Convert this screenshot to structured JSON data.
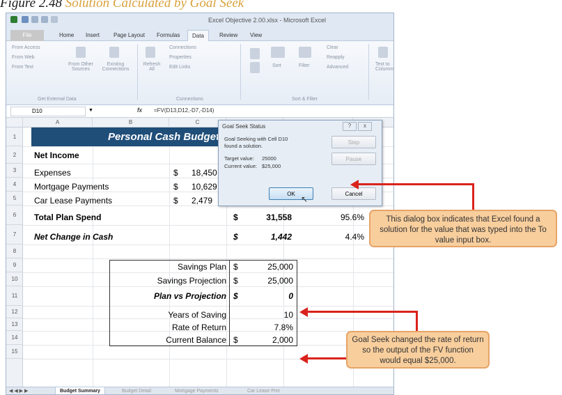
{
  "caption": {
    "figure": "Figure 2.48",
    "subtitle": "Solution Calculated by Goal Seek"
  },
  "window": {
    "title": "Excel Objective 2.00.xlsx - Microsoft Excel"
  },
  "ribbon_tabs": [
    "File",
    "Home",
    "Insert",
    "Page Layout",
    "Formulas",
    "Data",
    "Review",
    "View"
  ],
  "ribbon": {
    "get_external_data": {
      "items": [
        "From Access",
        "From Web",
        "From Text",
        "From Other Sources",
        "Existing Connections"
      ],
      "label": "Get External Data"
    },
    "connections": {
      "items": [
        "Refresh All",
        "Connections",
        "Properties",
        "Edit Links"
      ],
      "label": "Connections"
    },
    "sort_filter": {
      "items": [
        "Sort",
        "Filter",
        "Clear",
        "Reapply",
        "Advanced"
      ],
      "label": "Sort & Filter"
    },
    "data_tools": {
      "items": [
        "Text to Columns"
      ]
    }
  },
  "formula_bar": {
    "name_box": "D10",
    "fx": "fx",
    "formula": "=FV(D13,D12,-D7,-D14)"
  },
  "columns": [
    "A",
    "B",
    "C",
    "D",
    "E"
  ],
  "rows": [
    "1",
    "2",
    "3",
    "4",
    "5",
    "6",
    "7",
    "8",
    "9",
    "10",
    "11",
    "12",
    "13",
    "14",
    "15"
  ],
  "sheet": {
    "title": "Personal Cash Budget",
    "net_income": "Net Income",
    "expenses": {
      "label": "Expenses",
      "currency": "$",
      "value": "18,450"
    },
    "mortgage": {
      "label": "Mortgage Payments",
      "currency": "$",
      "value": "10,629"
    },
    "car_lease": {
      "label": "Car Lease Payments",
      "currency": "$",
      "value": "2,479"
    },
    "total_plan_spend": {
      "label": "Total Plan Spend",
      "currency": "$",
      "value": "31,558",
      "pct": "95.6%"
    },
    "net_change": {
      "label": "Net Change in Cash",
      "currency": "$",
      "value": "1,442",
      "pct": "4.4%"
    },
    "savings_plan": {
      "label": "Savings Plan",
      "currency": "$",
      "value": "25,000"
    },
    "savings_projection": {
      "label": "Savings Projection",
      "currency": "$",
      "value": "25,000"
    },
    "plan_vs_projection": {
      "label": "Plan vs Projection",
      "currency": "$",
      "value": "0"
    },
    "years_of_saving": {
      "label": "Years of Saving",
      "value": "10"
    },
    "rate_of_return": {
      "label": "Rate of Return",
      "value": "7.8%"
    },
    "current_balance": {
      "label": "Current Balance",
      "currency": "$",
      "value": "2,000"
    }
  },
  "sheet_tabs": [
    "Budget Summary",
    "Budget Detail",
    "Mortgage Payments",
    "Car Lease Pmt"
  ],
  "dialog": {
    "title": "Goal Seek Status",
    "message_line1": "Goal Seeking with Cell D10",
    "message_line2": "found a solution.",
    "target_label": "Target value:",
    "target_value": "25000",
    "current_label": "Current value:",
    "current_value": "$25,000",
    "step_button": "Step",
    "pause_button": "Pause",
    "ok_button": "OK",
    "cancel_button": "Cancel",
    "help_icon": "?",
    "close_icon": "x"
  },
  "callouts": {
    "dialog_note": "This dialog box indicates that Excel found a solution for the value that was typed into the To value input box.",
    "goal_seek_note": "Goal Seek changed the rate of return so the output of the FV function would equal $25,000."
  },
  "colors": {
    "banner": "#1f4e79",
    "callout_fill": "#f8ce9d",
    "callout_border": "#e6a467",
    "arrow": "#d9231c",
    "caption_sub": "#d9a13b"
  }
}
